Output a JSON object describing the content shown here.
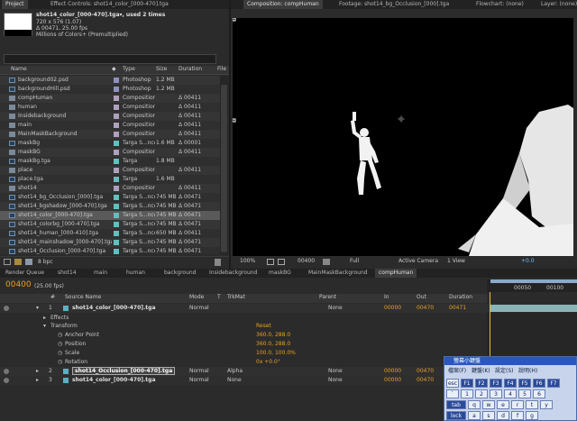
{
  "project_panel": {
    "tab_project": "Project",
    "tab_effect_controls": "Effect Controls: shot14_color_[000-470].tga",
    "info": {
      "name": "shot14_color_[000-470].tga▾, used 2 times",
      "dims": "720 x 576 (1.07)",
      "duration": "Δ 00471, 25.00 fps",
      "colors": "Millions of Colors+ (Premultiplied)"
    },
    "columns": {
      "name": "Name",
      "type": "Type",
      "size": "Size",
      "duration": "Duration",
      "file": "File"
    },
    "items": [
      {
        "name": "background02.psd",
        "type": "Photoshop",
        "size": "1.2 MB",
        "duration": "",
        "kind": "file",
        "color": "#9090c0"
      },
      {
        "name": "backgroundHill.psd",
        "type": "Photoshop",
        "size": "1.2 MB",
        "duration": "",
        "kind": "file",
        "color": "#9090c0"
      },
      {
        "name": "compHuman",
        "type": "Composition",
        "size": "",
        "duration": "Δ 00411",
        "kind": "comp",
        "color": "#b0a0c0"
      },
      {
        "name": "human",
        "type": "Composition",
        "size": "",
        "duration": "Δ 00411",
        "kind": "comp",
        "color": "#b0a0c0"
      },
      {
        "name": "Insidebackground",
        "type": "Composition",
        "size": "",
        "duration": "Δ 00411",
        "kind": "comp",
        "color": "#b0a0c0"
      },
      {
        "name": "main",
        "type": "Composition",
        "size": "",
        "duration": "Δ 00411",
        "kind": "comp",
        "color": "#b0a0c0"
      },
      {
        "name": "MainMaskBackground",
        "type": "Composition",
        "size": "",
        "duration": "Δ 00411",
        "kind": "comp",
        "color": "#b0a0c0"
      },
      {
        "name": "maskBg",
        "type": "Targa S...nce",
        "size": "1.6 MB",
        "duration": "Δ 00001",
        "kind": "file",
        "color": "#60c0c0"
      },
      {
        "name": "maskBG",
        "type": "Composition",
        "size": "",
        "duration": "Δ 00411",
        "kind": "comp",
        "color": "#b0a0c0"
      },
      {
        "name": "maskBg.tga",
        "type": "Targa",
        "size": "1.8 MB",
        "duration": "",
        "kind": "file",
        "color": "#60c0c0"
      },
      {
        "name": "place",
        "type": "Composition",
        "size": "",
        "duration": "Δ 00411",
        "kind": "comp",
        "color": "#b0a0c0"
      },
      {
        "name": "place.tga",
        "type": "Targa",
        "size": "1.6 MB",
        "duration": "",
        "kind": "file",
        "color": "#60c0c0"
      },
      {
        "name": "shot14",
        "type": "Composition",
        "size": "",
        "duration": "Δ 00411",
        "kind": "comp",
        "color": "#b0a0c0"
      },
      {
        "name": "shot14_bg_Occlusion_[000].tga",
        "type": "Targa S...nce",
        "size": "745 MB",
        "duration": "Δ 00471",
        "kind": "file",
        "color": "#60c0c0"
      },
      {
        "name": "shot14_bgshadow_[000-470].tga",
        "type": "Targa S...nce",
        "size": "745 MB",
        "duration": "Δ 00471",
        "kind": "file",
        "color": "#60c0c0"
      },
      {
        "name": "shot14_color_[000-470].tga",
        "type": "Targa S...nce",
        "size": "745 MB",
        "duration": "Δ 00471",
        "kind": "file",
        "color": "#60c0c0",
        "selected": true
      },
      {
        "name": "shot14_colorbg_[000-470].tga",
        "type": "Targa S...nce",
        "size": "745 MB",
        "duration": "Δ 00471",
        "kind": "file",
        "color": "#60c0c0"
      },
      {
        "name": "shot14_human_[000-410].tga",
        "type": "Targa S...nce",
        "size": "650 MB",
        "duration": "Δ 00411",
        "kind": "file",
        "color": "#60c0c0"
      },
      {
        "name": "shot14_mainshadow_[000-470].tga",
        "type": "Targa S...nce",
        "size": "745 MB",
        "duration": "Δ 00471",
        "kind": "file",
        "color": "#60c0c0"
      },
      {
        "name": "shot14_Occlusion_[000-470].tga",
        "type": "Targa S...nce",
        "size": "745 MB",
        "duration": "Δ 00471",
        "kind": "file",
        "color": "#60c0c0"
      }
    ],
    "bpc": "8 bpc"
  },
  "viewer": {
    "tab_composition": "Composition: compHuman",
    "tab_footage": "Footage: shot14_bg_Occlusion_[000].tga",
    "tab_flowchart": "Flowchart: (none)",
    "tab_layer": "Layer: (none)",
    "zoom": "100%",
    "timecode": "00400",
    "resolution": "Full",
    "camera": "Active Camera",
    "view": "1 View",
    "exposure": "+0.0"
  },
  "timeline": {
    "tabs": [
      "Render Queue",
      "shot14",
      "main",
      "human",
      "background",
      "Insidebackground",
      "maskBG",
      "MainMaskBackground",
      "compHuman"
    ],
    "current_time": "00400",
    "fps": "(25.00 fps)",
    "columns": {
      "num": "#",
      "source": "Source Name",
      "mode": "Mode",
      "t": "T",
      "trkmat": "TrkMat",
      "parent": "Parent",
      "in": "In",
      "out": "Out",
      "duration": "Duration"
    },
    "ruler": [
      "00050",
      "00100"
    ],
    "layers": [
      {
        "num": "1",
        "name": "shot14_color_[000-470].tga",
        "mode": "Normal",
        "trkmat": "",
        "parent": "None",
        "in": "00000",
        "out": "00470",
        "duration": "00471"
      },
      {
        "num": "2",
        "name": "shot14_Occlusion_[000-470].tga",
        "mode": "Normal",
        "trkmat": "Alpha",
        "parent": "None",
        "in": "00000",
        "out": "00470",
        "duration": "00471"
      },
      {
        "num": "3",
        "name": "shot14_color_[000-470].tga",
        "mode": "Normal",
        "trkmat": "None",
        "parent": "None",
        "in": "00000",
        "out": "00470",
        "duration": "00471"
      }
    ],
    "effects_label": "Effects",
    "transform_label": "Transform",
    "reset_label": "Reset",
    "props": [
      {
        "name": "Anchor Point",
        "value": "360.0, 288.0"
      },
      {
        "name": "Position",
        "value": "360.0, 288.0"
      },
      {
        "name": "Scale",
        "value": "100.0, 100.0%"
      },
      {
        "name": "Rotation",
        "value": "0x +0.0°"
      },
      {
        "name": "Opacity",
        "value": "100%"
      }
    ]
  },
  "keyboard": {
    "title": "螢幕小鍵盤",
    "menu": [
      "檔案(F)",
      "鍵盤(K)",
      "設定(S)",
      "說明(H)"
    ],
    "row1": [
      "esc",
      "F1",
      "F2",
      "F3",
      "F4",
      "F5",
      "F6",
      "F7"
    ],
    "row2": [
      "`",
      "1",
      "2",
      "3",
      "4",
      "5",
      "6"
    ],
    "row3": [
      "tab",
      "q",
      "w",
      "e",
      "r",
      "t",
      "y"
    ],
    "row4": [
      "lock",
      "a",
      "s",
      "d",
      "f",
      "g"
    ]
  }
}
